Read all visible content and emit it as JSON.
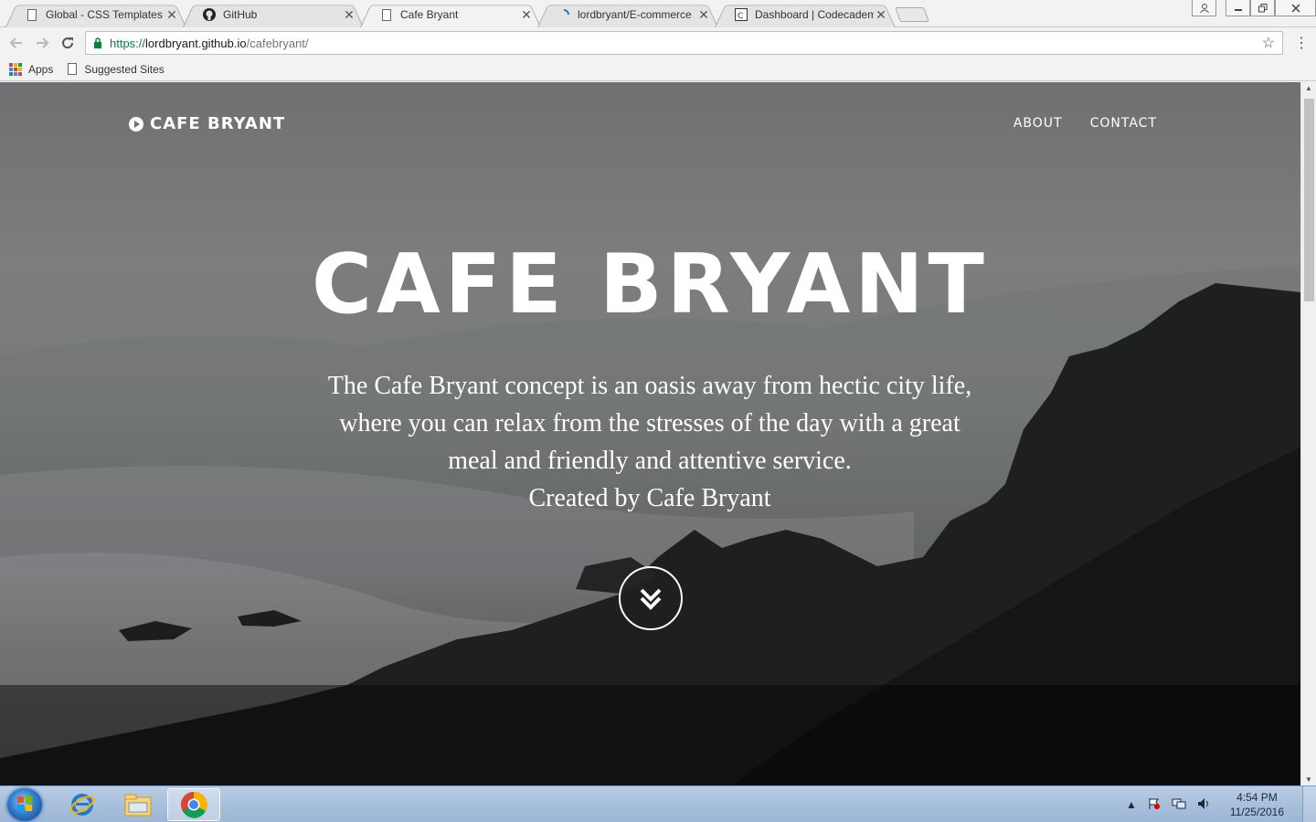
{
  "browser": {
    "tabs": [
      {
        "title": "Global - CSS Templates",
        "icon": "page-icon"
      },
      {
        "title": "GitHub",
        "icon": "github-icon"
      },
      {
        "title": "Cafe Bryant",
        "icon": "page-icon",
        "active": true
      },
      {
        "title": "lordbryant/E-commerce",
        "icon": "loading-icon"
      },
      {
        "title": "Dashboard | Codecadem",
        "icon": "codecademy-icon"
      }
    ],
    "tab_close_glyph": "✕",
    "url_scheme": "https://",
    "url_host": "lordbryant.github.io",
    "url_path": "/cafebryant/",
    "bookmarks": [
      {
        "label": "Apps",
        "icon": "apps-grid-icon"
      },
      {
        "label": "Suggested Sites",
        "icon": "page-icon"
      }
    ]
  },
  "site": {
    "brand": "CAFE BRYANT",
    "nav": [
      "ABOUT",
      "CONTACT"
    ],
    "hero_title": "CAFE BRYANT",
    "hero_lines": [
      "The Cafe Bryant concept is an oasis away from hectic city life,",
      "where you can relax from the stresses of the day with a great",
      "meal and friendly and attentive service."
    ],
    "hero_credit": "Created by Cafe Bryant"
  },
  "taskbar": {
    "apps": [
      "internet-explorer-icon",
      "file-explorer-icon",
      "chrome-icon"
    ],
    "time": "4:54 PM",
    "date": "11/25/2016"
  },
  "colors": {
    "brand_text": "#ffffff",
    "secure_green": "#0b8043",
    "taskbar": "#a8c0dc"
  }
}
